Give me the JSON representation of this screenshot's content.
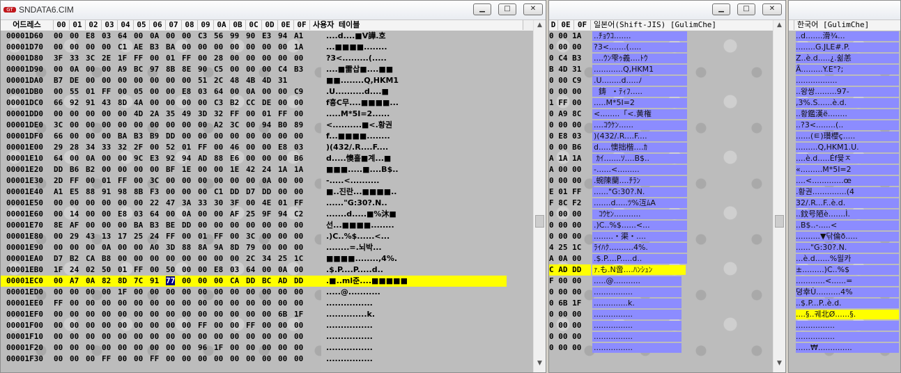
{
  "win1": {
    "title": "SNDATA6.CIM",
    "header": {
      "address": "어드레스",
      "cols": [
        "00",
        "01",
        "02",
        "03",
        "04",
        "05",
        "06",
        "07",
        "08",
        "09",
        "0A",
        "0B",
        "0C",
        "0D",
        "0E",
        "0F"
      ],
      "text": "사용자 테이블"
    },
    "rows": [
      {
        "addr": "00001D60",
        "hex": "00 00 E8 03 64 00 0A 00 00 C3 56 99 90 E3 94 A1",
        "text": "....d....■V譁.호"
      },
      {
        "addr": "00001D70",
        "hex": "00 00 00 00 C1 AE B3 BA 00 00 00 00 00 00 00 1A",
        "text": "...■■■■........"
      },
      {
        "addr": "00001D80",
        "hex": "3F 33 3C 2E 1F FF 00 01 FF 00 28 00 00 00 00 00",
        "text": "?3<.........(....."
      },
      {
        "addr": "00001D90",
        "hex": "00 0A 00 00 A9 BC 97 8B 8E 90 C5 00 00 00 C4 B3",
        "text": "....■雷삽■....■■"
      },
      {
        "addr": "00001DA0",
        "hex": "B7 DE 00 00 00 00 00 00 00 51 2C 48 4B 4D 31",
        "text": "■■........Q,HKM1"
      },
      {
        "addr": "00001DB0",
        "hex": "00 55 01 FF 00 05 00 00 E8 03 64 00 0A 00 00 C9",
        "text": ".U..........d....■"
      },
      {
        "addr": "00001DC0",
        "hex": "66 92 91 43 8D 4A 00 00 00 00 C3 B2 CC DE 00 00",
        "text": "f흉C무....■■■■..."
      },
      {
        "addr": "00001DD0",
        "hex": "00 00 00 00 00 4D 2A 35 49 3D 32 FF 00 01 FF 00",
        "text": ".....M*5I=2......"
      },
      {
        "addr": "00001DE0",
        "hex": "3C 00 00 00 00 00 00 00 00 00 A2 3C 00 94 B0 89",
        "text": "<..........■<.황권"
      },
      {
        "addr": "00001DF0",
        "hex": "66 00 00 00 BA B3 B9 DD 00 00 00 00 00 00 00 00",
        "text": "f...■■■■........"
      },
      {
        "addr": "00001E00",
        "hex": "29 28 34 33 32 2F 00 52 01 FF 00 46 00 00 E8 03",
        "text": ")(432/.R....F...."
      },
      {
        "addr": "00001E10",
        "hex": "64 00 0A 00 00 9C E3 92 94 AD 88 E6 00 00 00 B6",
        "text": "d.....懊홀■계...■"
      },
      {
        "addr": "00001E20",
        "hex": "DD B6 B2 00 00 00 00 BF 1E 00 00 1E 42 24 1A 1A",
        "text": "■■■.....■....B$.."
      },
      {
        "addr": "00001E30",
        "hex": "2D FF 00 01 FF 00 3C 00 00 00 00 00 00 0A 00 00",
        "text": "-.....<.........."
      },
      {
        "addr": "00001E40",
        "hex": "A1 E5 88 91 98 8B F3 00 00 00 C1 DD D7 DD 00 00",
        "text": "■..진란...■■■■.."
      },
      {
        "addr": "00001E50",
        "hex": "00 00 00 00 00 00 22 47 3A 33 30 3F 00 4E 01 FF",
        "text": "......\"G:30?.N.."
      },
      {
        "addr": "00001E60",
        "hex": "00 14 00 00 E8 03 64 00 0A 00 00 AF 25 9F 94 C2",
        "text": ".......d.....■%沐■"
      },
      {
        "addr": "00001E70",
        "hex": "8E AF 00 00 00 BA B3 BE DD 00 00 00 00 00 00 00",
        "text": "선...■■■■........"
      },
      {
        "addr": "00001E80",
        "hex": "00 29 43 13 17 25 24 FF 00 01 FF 00 3C 00 00 00",
        "text": ".)C..%$......<..."
      },
      {
        "addr": "00001E90",
        "hex": "00 00 00 0A 00 00 A0 3D 88 8A 9A 8D 79 00 00 00",
        "text": "........=.뇌박..."
      },
      {
        "addr": "00001EA0",
        "hex": "D7 B2 CA B8 00 00 00 00 00 00 00 00 2C 34 25 1C",
        "text": "■■■■........,4%."
      },
      {
        "addr": "00001EB0",
        "hex": "1F 24 02 50 01 FF 00 50 00 00 E8 03 64 00 0A 00",
        "text": ".$.P....P.....d.."
      },
      {
        "addr": "00001EC0",
        "hex": "00 A7 0A 82 8D 7C 91 77 00 00 00 CA DD BC AD DD",
        "text": ".■..ml준....■■■■■"
      },
      {
        "addr": "00001ED0",
        "hex": "00 00 00 00 1F 00 00 00 00 00 00 00 00 00 00 00",
        "text": ".....@..........."
      },
      {
        "addr": "00001EE0",
        "hex": "FF 00 00 00 00 00 00 00 00 00 00 00 00 00 00 00",
        "text": "................"
      },
      {
        "addr": "00001EF0",
        "hex": "00 00 00 00 00 00 00 00 00 00 00 00 00 00 6B 1F",
        "text": "..............k."
      },
      {
        "addr": "00001F00",
        "hex": "00 00 00 00 00 00 00 00 00 FF 00 00 FF 00 00 00",
        "text": "................"
      },
      {
        "addr": "00001F10",
        "hex": "00 00 00 00 00 00 00 00 00 00 00 00 00 00 00 00",
        "text": "................"
      },
      {
        "addr": "00001F20",
        "hex": "00 00 00 00 00 00 00 00 00 96 1F 00 00 00 00 00",
        "text": "................"
      },
      {
        "addr": "00001F30",
        "hex": "00 00 00 FF 00 00 FF 00 00 00 00 00 00 00 00 00",
        "text": "................"
      }
    ]
  },
  "win2": {
    "header": {
      "cols": [
        "D",
        "0E",
        "0F"
      ],
      "text": "일본어(Shift-JIS) [GulimChe]"
    },
    "rows": [
      {
        "hex": "0 00 1A",
        "text": "..ﾁｮｳｺ......."
      },
      {
        "hex": "0 00 00",
        "text": "?3<.......(....."
      },
      {
        "hex": "0 C4 B3",
        "text": "....ｳﾝ雫ｩ義....ﾄｳ"
      },
      {
        "hex": "B 4D 31",
        "text": "............Q,HKM1"
      },
      {
        "hex": "0 00 C9",
        "text": ".U........d.....ﾉ"
      },
      {
        "hex": "0 00 00",
        "text": "  鋳  ・ﾃｨﾌ....."
      },
      {
        "hex": "1 FF 00",
        "text": ".....M*5I=2"
      },
      {
        "hex": "0 A9 8C",
        "text": "<........「<.黄権"
      },
      {
        "hex": "0 00 00",
        "text": "....ｺｳｹﾝ......"
      },
      {
        "hex": "0 E8 03",
        "text": ")(432/.R....F...."
      },
      {
        "hex": "0 00 B6",
        "text": "d.....懊拙楷....ｶ"
      },
      {
        "hex": "A 1A 1A",
        "text": " ｶｲ.......ｿ....B$.."
      },
      {
        "hex": "A 00 00",
        "text": "-......<........."
      },
      {
        "hex": "0 00 00",
        "text": ".蜿陳蘭....ﾁﾗﾝ"
      },
      {
        "hex": "E 01 FF",
        "text": "......\"G:30?.N."
      },
      {
        "hex": "F 8C F2",
        "text": ".......d.....ﾂ%沍ﾑA"
      },
      {
        "hex": "0 00 00",
        "text": "  ｺｳｾﾝ..........."
      },
      {
        "hex": "0 00 00",
        "text": ".)C..%$......<..."
      },
      {
        "hex": "0 00 00",
        "text": "........・渠・...."
      },
      {
        "hex": "4 25 1C",
        "text": "ﾗｲﾊｸ..........4%."
      },
      {
        "hex": "A 0A 00",
        "text": ".$.P....P.....d.."
      },
      {
        "hex": "C AD DD",
        "text": "ｧ.も.N啻....ﾊﾝｼｭﾝ"
      },
      {
        "hex": "F 00 00",
        "text": ".....@..........."
      },
      {
        "hex": "0 00 00",
        "text": "................"
      },
      {
        "hex": "0 6B 1F",
        "text": "..............k."
      },
      {
        "hex": "0 00 00",
        "text": "................"
      },
      {
        "hex": "0 00 00",
        "text": "................"
      },
      {
        "hex": "0 00 00",
        "text": "................"
      },
      {
        "hex": "0 00 00",
        "text": "................"
      }
    ]
  },
  "win3": {
    "header": {
      "text": "한국어 [GulimChe]"
    },
    "rows": [
      {
        "text": "..d.......滑¾..."
      },
      {
        "text": "........G.JLE#.P."
      },
      {
        "text": "Z..è.d.....¿.쉶恙"
      },
      {
        "text": "Ã.........Y.E\"?;"
      },
      {
        "text": "................."
      },
      {
        "text": "..왕쌍.........97-"
      },
      {
        "text": ",3%.S......è.d."
      },
      {
        "text": "..황鑑漢ë........"
      },
      {
        "text": "..?3<........(.."
      },
      {
        "text": "......(ㅌ)瓚櫻ç....."
      },
      {
        "text": ".........Q,HKM1.U."
      },
      {
        "text": "....è.d.....Éf뮻ㅈ"
      },
      {
        "text": "«.........M*5I=2"
      },
      {
        "text": "....<.............œ"
      },
      {
        "text": ".황권..............(4"
      },
      {
        "text": "32/.R...F..è.d."
      },
      {
        "text": "..鈫号陋è.......Ì."
      },
      {
        "text": "..B$..-.....<"
      },
      {
        "text": "..........▼닦倫ð....."
      },
      {
        "text": "......\"G:30?.N."
      },
      {
        "text": "...è.d......%읠카"
      },
      {
        "text": "±.........)C..%$"
      },
      {
        "text": "............<......="
      },
      {
        "text": "뎡幸Ù..........4%"
      },
      {
        "text": "..$.P...P..è.d."
      },
      {
        "text": "....§..궤北Ø......§."
      },
      {
        "text": "................"
      },
      {
        "text": "................"
      },
      {
        "text": "......₩.............."
      }
    ]
  },
  "colors": {
    "selection": "#ffff00",
    "caret": "#000080",
    "highlight": "#8c8cff"
  }
}
